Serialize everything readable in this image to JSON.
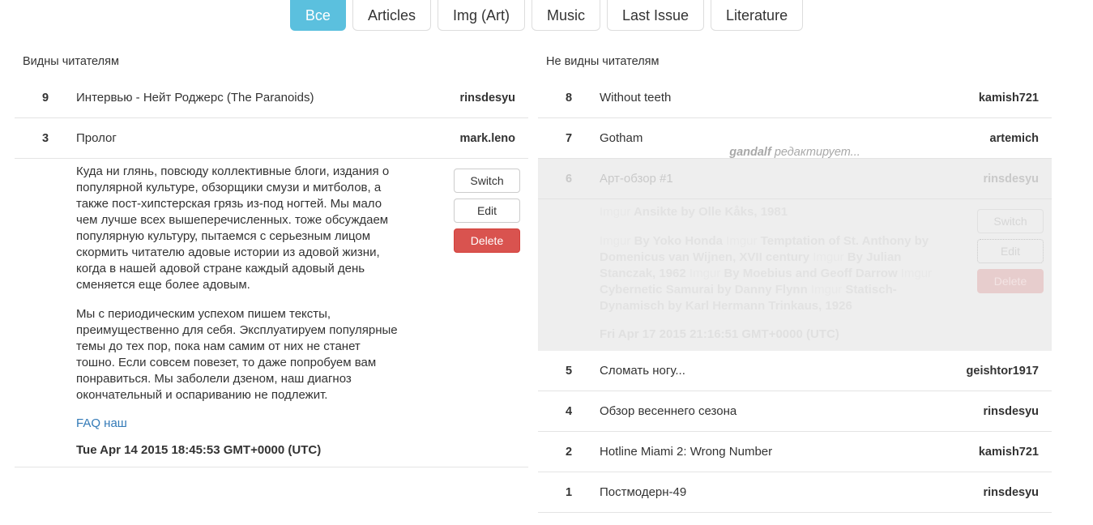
{
  "tabs": [
    {
      "label": "Все",
      "active": true
    },
    {
      "label": "Articles",
      "active": false
    },
    {
      "label": "Img (Art)",
      "active": false
    },
    {
      "label": "Music",
      "active": false
    },
    {
      "label": "Last Issue",
      "active": false
    },
    {
      "label": "Literature",
      "active": false
    }
  ],
  "left": {
    "heading": "Видны читателям",
    "rows": [
      {
        "num": "9",
        "title": "Интервью - Нейт Роджерс (The Paranoids)",
        "author": "rinsdesyu"
      },
      {
        "num": "3",
        "title": "Пролог",
        "author": "mark.leno"
      }
    ],
    "expanded": {
      "paragraph1": "Куда ни глянь, повсюду коллективные блоги, издания о популярной культуре, обзорщики смузи и митболов, а также пост-хипстерская грязь из-под ногтей. Мы мало чем лучше всех вышеперечисленных. тоже обсуждаем популярную культуру, пытаемся с серьезным лицом скормить читателю адовые истории из адовой жизни, когда в нашей адовой стране каждый адовый день сменяется еще более адовым.",
      "paragraph2": "Мы с периодическим успехом пишем тексты, преимущественно для себя. Эксплуатируем популярные темы до тех пор, пока нам самим от них не станет тошно. Если совсем повезет, то даже попробуем вам понравиться. Мы заболели дзеном, наш диагноз окончательный и оспариванию не подлежит.",
      "link": "FAQ наш",
      "date": "Tue Apr 14 2015 18:45:53 GMT+0000 (UTC)",
      "buttons": {
        "switch": "Switch",
        "edit": "Edit",
        "delete": "Delete"
      }
    }
  },
  "right": {
    "heading": "Не видны читателям",
    "rows_top": [
      {
        "num": "8",
        "title": "Without teeth",
        "author": "kamish721"
      },
      {
        "num": "7",
        "title": "Gotham",
        "author": "artemich"
      }
    ],
    "locked": {
      "editing_user": "gandalf",
      "editing_text": "редактирует...",
      "row": {
        "num": "6",
        "title": "Арт-обзор #1",
        "author": "rinsdesyu"
      },
      "line1_imgur": "Imgur",
      "line1_text": "Ansikte by Olle Kåks, 1981",
      "body_parts": [
        {
          "imgur": "Imgur",
          "text": "By Yoko Honda "
        },
        {
          "imgur": "Imgur",
          "text": "Temptation of St. Anthony by Domenicus van Wijnen, XVII century "
        },
        {
          "imgur": "Imgur",
          "text": "By Julian Stanczak, 1962 "
        },
        {
          "imgur": "Imgur",
          "text": "By Moebius and Geoff Darrow "
        },
        {
          "imgur": "Imgur",
          "text": "Cybernetic Samurai by Danny Flynn "
        },
        {
          "imgur": "Imgur",
          "text": "Statisch-Dynamisch by Karl Hermann Trinkaus, 1926"
        }
      ],
      "date": "Fri Apr 17 2015 21:16:51 GMT+0000 (UTC)",
      "buttons": {
        "switch": "Switch",
        "edit": "Edit",
        "delete": "Delete"
      }
    },
    "rows_bottom": [
      {
        "num": "5",
        "title": "Сломать ногу...",
        "author": "geishtor1917"
      },
      {
        "num": "4",
        "title": "Обзор весеннего сезона",
        "author": "rinsdesyu"
      },
      {
        "num": "2",
        "title": "Hotline Miami 2: Wrong Number",
        "author": "kamish721"
      },
      {
        "num": "1",
        "title": "Постмодерн-49",
        "author": "rinsdesyu"
      }
    ]
  },
  "colors": {
    "active_tab": "#5bc0de",
    "danger": "#d9534f",
    "link": "#337ab7",
    "locked_bg": "#eeeeee"
  }
}
